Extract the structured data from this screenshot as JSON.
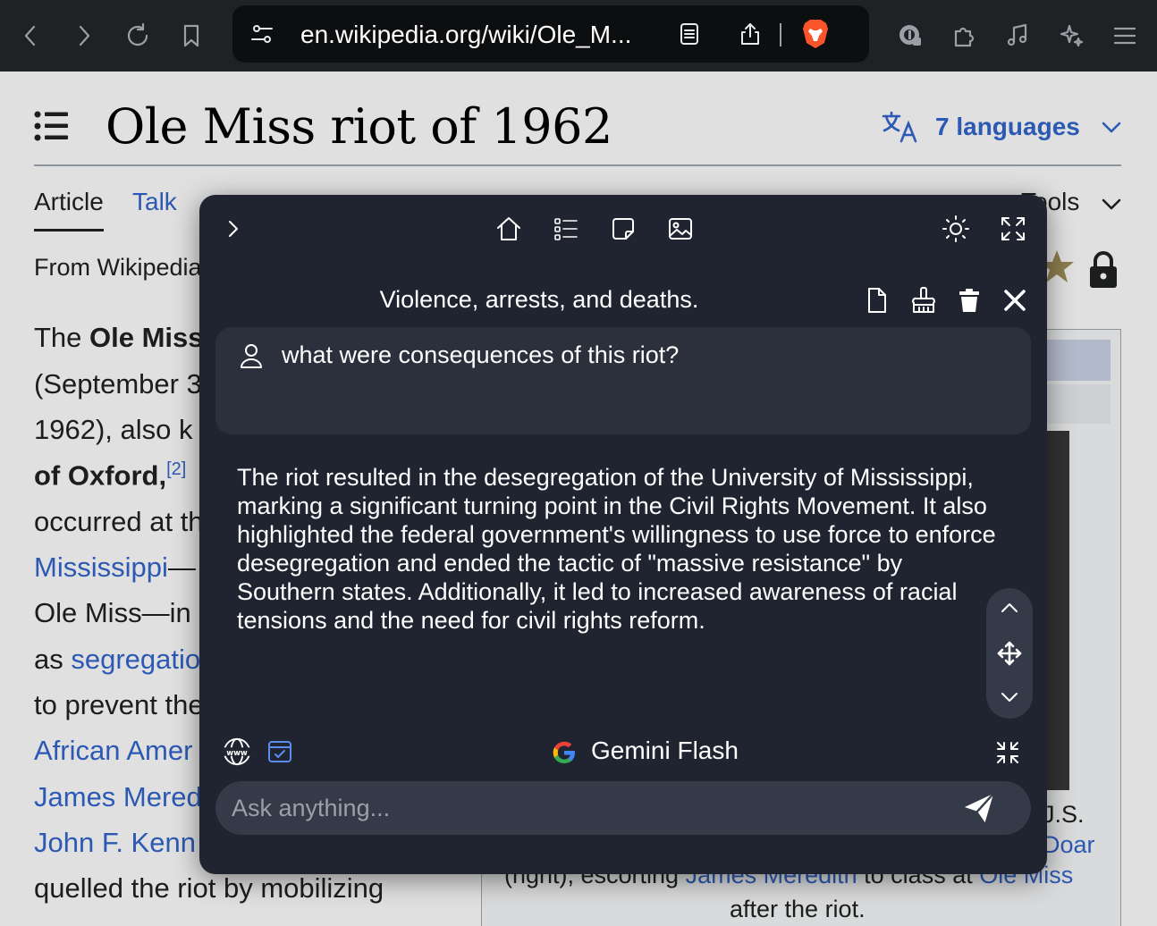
{
  "browser": {
    "url": "en.wikipedia.org/wiki/Ole_M..."
  },
  "wiki": {
    "title": "Ole Miss riot of 1962",
    "languages": "7 languages",
    "tab_article": "Article",
    "tab_talk": "Talk",
    "tab_tools": "Tools",
    "from": "From Wikipedia",
    "body": {
      "l1_a": "The ",
      "l1_b": "Ole Miss",
      "l2": "(September 3",
      "l3": "1962), also k",
      "l4_a": "of Oxford,",
      "l4_ref": "[2]",
      "l5": "occurred at th",
      "l6_link": "Mississippi",
      "l6_b": "—",
      "l7": "Ole Miss—in",
      "l8_a": "as ",
      "l8_link": "segregatio",
      "l9": "to prevent the",
      "l10_link": "African Amer",
      "l11_link": "James Mered",
      "l12_link": "John F. Kenn",
      "l13": "quelled the riot by mobilizing"
    },
    "caption": {
      "us": "J.S.",
      "doar": "Doar",
      "line_a": "(right), escorting ",
      "line_link1": "James Meredith",
      "line_b": " to class at ",
      "line_link2": "Ole Miss",
      "after": "after the riot."
    }
  },
  "assistant": {
    "title": "Violence, arrests, and deaths.",
    "user_question": "what were consequences of this riot?",
    "answer": "The riot resulted in the desegregation of the University of Mississippi, marking a significant turning point in the Civil Rights Movement. It also highlighted the federal government's willingness to use force to enforce desegregation and ended the tactic of \"massive resistance\" by Southern states. Additionally, it led to increased awareness of racial tensions and the need for civil rights reform.",
    "model": "Gemini Flash",
    "input_placeholder": "Ask anything..."
  },
  "icons": {
    "back": "back-arrow-icon",
    "forward": "forward-arrow-icon",
    "reload": "reload-icon",
    "bookmark": "bookmark-icon",
    "site_settings": "site-settings-icon",
    "reader": "reader-mode-icon",
    "share": "share-icon",
    "brave": "brave-shields-icon",
    "password": "password-manager-icon",
    "extensions": "extensions-icon",
    "music": "music-icon",
    "leo": "ai-sparkle-icon",
    "menu": "hamburger-menu-icon"
  },
  "colors": {
    "toolbar_bg": "#202124",
    "panel_bg": "#1f2430",
    "link": "#3366cc",
    "brave_orange": "#fb542b"
  }
}
